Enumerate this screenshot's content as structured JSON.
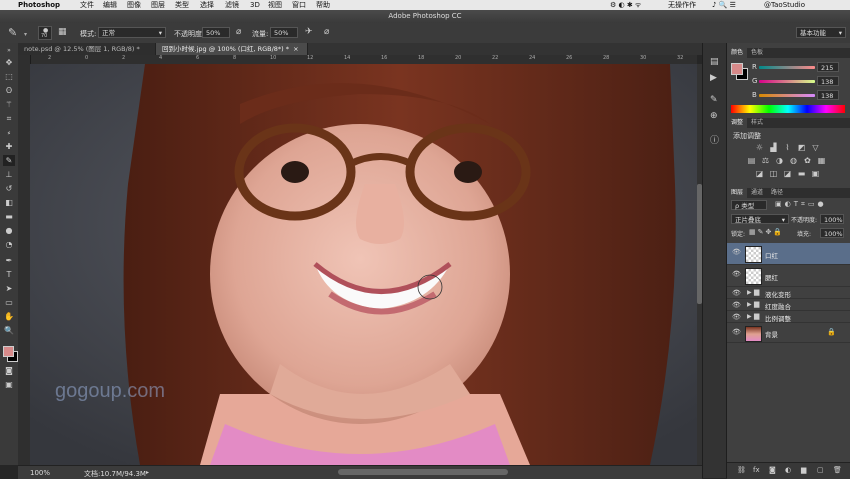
{
  "menubar": {
    "app": "Photoshop",
    "items": [
      "文件",
      "编辑",
      "图像",
      "图层",
      "类型",
      "选择",
      "滤镜",
      "3D",
      "视图",
      "窗口",
      "帮助"
    ],
    "right_label": "无操作作",
    "user": "@TaoStudio"
  },
  "titlebar": {
    "title": "Adobe Photoshop CC"
  },
  "options": {
    "brush_size": "70",
    "mode_label": "模式:",
    "mode_value": "正常",
    "opacity_label": "不透明度:",
    "opacity_value": "50%",
    "flow_label": "流量:",
    "flow_value": "50%",
    "workspace": "基本功能"
  },
  "tabs": [
    {
      "label": "note.psd @ 12.5% (图层 1, RGB/8) *",
      "active": false
    },
    {
      "label": "回到小时候.jpg @ 100% (口红, RGB/8*) *",
      "active": true
    }
  ],
  "ruler_ticks": [
    "2",
    "0",
    "2",
    "4",
    "6",
    "8",
    "10",
    "12",
    "14",
    "16",
    "18",
    "20",
    "22",
    "24",
    "26",
    "28",
    "30",
    "32"
  ],
  "watermark": "gogoup.com",
  "status": {
    "zoom": "100%",
    "doc_size": "文档:10.7M/94.3M"
  },
  "color_panel": {
    "tabs": [
      "颜色",
      "色板"
    ],
    "r_label": "R",
    "r": "215",
    "g_label": "G",
    "g": "138",
    "b_label": "B",
    "b": "138",
    "fg_color": "#d78a8a"
  },
  "adjust_panel": {
    "tabs": [
      "调整",
      "样式"
    ],
    "title": "添加调整"
  },
  "layers_panel": {
    "tabs": [
      "图层",
      "通道",
      "路径"
    ],
    "filter_label": "ρ 类型",
    "blend_mode": "正片叠底",
    "opacity_label": "不透明度:",
    "opacity": "100%",
    "lock_label": "锁定:",
    "fill_label": "填充:",
    "fill": "100%",
    "layers": [
      {
        "name": "口红",
        "type": "pixel",
        "selected": true
      },
      {
        "name": "腮红",
        "type": "pixel",
        "selected": false
      },
      {
        "name": "液化变形",
        "type": "group",
        "selected": false
      },
      {
        "name": "红度融合",
        "type": "group",
        "selected": false
      },
      {
        "name": "比例调整",
        "type": "group",
        "selected": false
      },
      {
        "name": "背景",
        "type": "background",
        "selected": false
      }
    ]
  },
  "icons": [
    "apple-icon",
    "brush-icon",
    "move-icon",
    "marquee-icon",
    "lasso-icon",
    "wand-icon",
    "crop-icon",
    "eyedropper-icon",
    "heal-icon",
    "brush-tool-icon",
    "stamp-icon",
    "history-brush-icon",
    "eraser-icon",
    "gradient-icon",
    "blur-icon",
    "dodge-icon",
    "pen-icon",
    "type-icon",
    "path-select-icon",
    "shape-icon",
    "hand-icon",
    "zoom-icon",
    "eye-icon",
    "folder-icon",
    "lock-icon",
    "link-icon",
    "fx-icon",
    "mask-icon",
    "new-layer-icon",
    "trash-icon"
  ]
}
